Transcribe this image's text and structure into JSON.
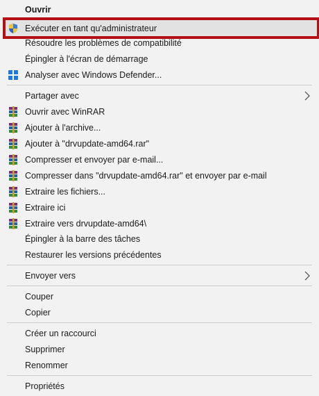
{
  "menu": {
    "items": [
      {
        "label": "Ouvrir"
      },
      {
        "label": "Exécuter en tant qu'administrateur",
        "icon": "uac-shield-icon"
      },
      {
        "label": "Résoudre les problèmes de compatibilité"
      },
      {
        "label": "Épingler à l'écran de démarrage"
      },
      {
        "label": "Analyser avec Windows Defender...",
        "icon": "windows-defender-icon"
      },
      {
        "label": "Partager avec"
      },
      {
        "label": "Ouvrir avec WinRAR",
        "icon": "winrar-icon"
      },
      {
        "label": "Ajouter à l'archive...",
        "icon": "winrar-icon"
      },
      {
        "label": "Ajouter à \"drvupdate-amd64.rar\"",
        "icon": "winrar-icon"
      },
      {
        "label": "Compresser et envoyer par e-mail...",
        "icon": "winrar-icon"
      },
      {
        "label": "Compresser dans \"drvupdate-amd64.rar\" et envoyer par e-mail",
        "icon": "winrar-icon"
      },
      {
        "label": "Extraire les fichiers...",
        "icon": "winrar-icon"
      },
      {
        "label": "Extraire ici",
        "icon": "winrar-icon"
      },
      {
        "label": "Extraire vers drvupdate-amd64\\",
        "icon": "winrar-icon"
      },
      {
        "label": "Épingler à la barre des tâches"
      },
      {
        "label": "Restaurer les versions précédentes"
      },
      {
        "label": "Envoyer vers"
      },
      {
        "label": "Couper"
      },
      {
        "label": "Copier"
      },
      {
        "label": "Créer un raccourci"
      },
      {
        "label": "Supprimer"
      },
      {
        "label": "Renommer"
      },
      {
        "label": "Propriétés"
      }
    ]
  },
  "colors": {
    "menu_background": "#f2f2f2",
    "highlight_border": "#b50f16",
    "highlight_fill": "#e2e2e2",
    "separator": "#cccccc"
  }
}
